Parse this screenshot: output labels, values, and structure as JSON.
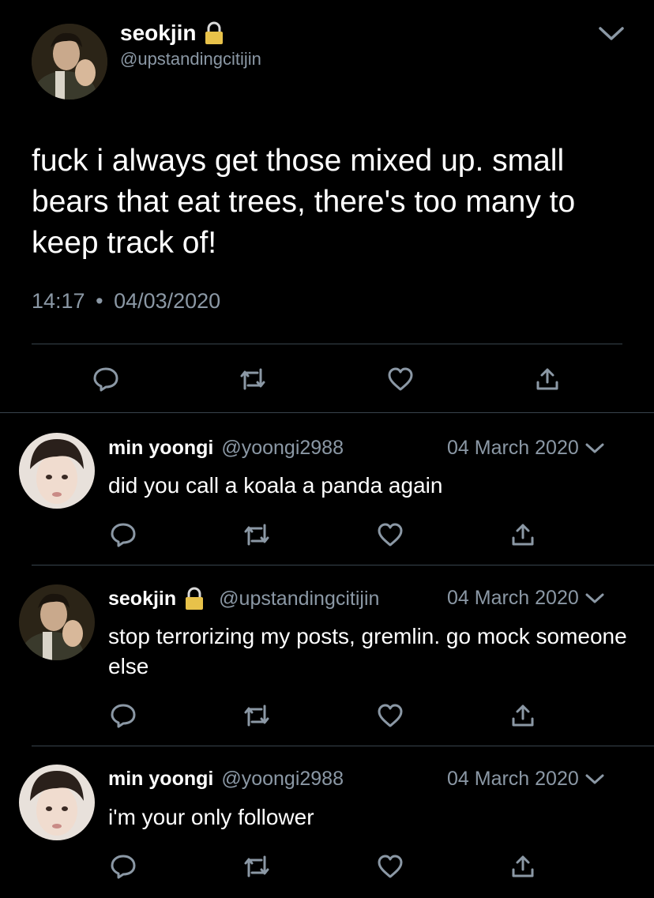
{
  "main_tweet": {
    "display_name": "seokjin",
    "handle": "@upstandingcitijin",
    "text": "fuck i always get those mixed up. small bears that eat trees, there's too many to keep track of!",
    "time": "14:17",
    "separator": "•",
    "date": "04/03/2020"
  },
  "replies": [
    {
      "display_name": "min yoongi",
      "handle": "@yoongi2988",
      "date": "04 March 2020",
      "text": "did you call a koala a panda again"
    },
    {
      "display_name": "seokjin",
      "handle": "@upstandingcitijin",
      "date": "04 March 2020",
      "text": "stop terrorizing my posts, gremlin. go mock someone else"
    },
    {
      "display_name": "min yoongi",
      "handle": "@yoongi2988",
      "date": "04 March 2020",
      "text": "i'm your only follower"
    }
  ],
  "icons": {
    "lock": "lock-icon",
    "chevron": "chevron-down-icon",
    "reply": "reply-icon",
    "retweet": "retweet-icon",
    "like": "heart-icon",
    "share": "share-icon"
  },
  "colors": {
    "background": "#000000",
    "text": "#ffffff",
    "muted": "#8b98a5",
    "divider": "#38444d",
    "lock": "#e8c24a"
  }
}
